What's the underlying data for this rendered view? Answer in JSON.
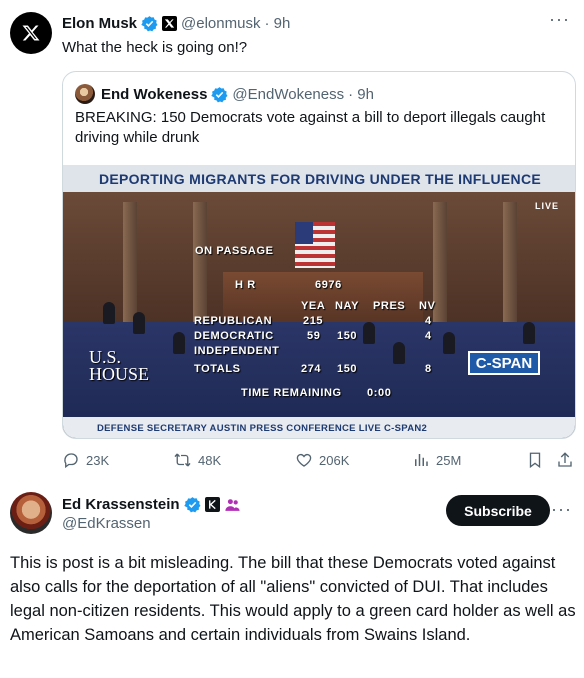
{
  "post1": {
    "author": {
      "name": "Elon Musk",
      "handle": "@elonmusk",
      "time": "· 9h",
      "verified": true,
      "avatar_icon": "x-logo-icon"
    },
    "text": "What the heck is going on!?",
    "more_icon": "more-dots-icon",
    "quote": {
      "author": {
        "name": "End Wokeness",
        "handle": "@EndWokeness",
        "time": "· 9h",
        "verified": true
      },
      "text": "BREAKING: 150 Democrats vote against a bill to deport illegals caught driving while drunk",
      "video": {
        "top_banner": "DEPORTING MIGRANTS FOR DRIVING UNDER THE INFLUENCE",
        "live_tag": "LIVE",
        "on_passage": "ON PASSAGE",
        "hr": "H R",
        "bill_number": "6976",
        "col_yea": "YEA",
        "col_nay": "NAY",
        "col_pres": "PRES",
        "col_nv": "NV",
        "rows": [
          {
            "party": "REPUBLICAN",
            "yea": "215",
            "nay": "",
            "pres": "",
            "nv": "4"
          },
          {
            "party": "DEMOCRATIC",
            "yea": "59",
            "nay": "150",
            "pres": "",
            "nv": "4"
          },
          {
            "party": "INDEPENDENT",
            "yea": "",
            "nay": "",
            "pres": "",
            "nv": ""
          },
          {
            "party": "TOTALS",
            "yea": "274",
            "nay": "150",
            "pres": "",
            "nv": "8"
          }
        ],
        "time_remaining_label": "TIME REMAINING",
        "time_remaining": "0:00",
        "us_house": [
          "U.S.",
          "HOUSE"
        ],
        "network_logo": "C-SPAN",
        "bottom_ticker": "DEFENSE SECRETARY AUSTIN PRESS CONFERENCE  LIVE C-SPAN2"
      }
    },
    "actions": {
      "replies": "23K",
      "reposts": "48K",
      "likes": "206K",
      "views": "25M"
    }
  },
  "post2": {
    "author": {
      "name": "Ed Krassenstein",
      "handle": "@EdKrassen",
      "verified": true
    },
    "subscribe_label": "Subscribe",
    "text": "This is post is a bit misleading. The bill that these Democrats voted against also calls for the deportation of all \"aliens\" convicted of DUI. That includes legal non-citizen residents. This would apply to a green card holder as well as American Samoans and certain individuals from Swains Island."
  },
  "colors": {
    "verified": "#1d9bf0",
    "muted": "#536471",
    "text": "#0f1419",
    "border": "#cfd9de",
    "cspan_blue": "#1e5aa8"
  }
}
